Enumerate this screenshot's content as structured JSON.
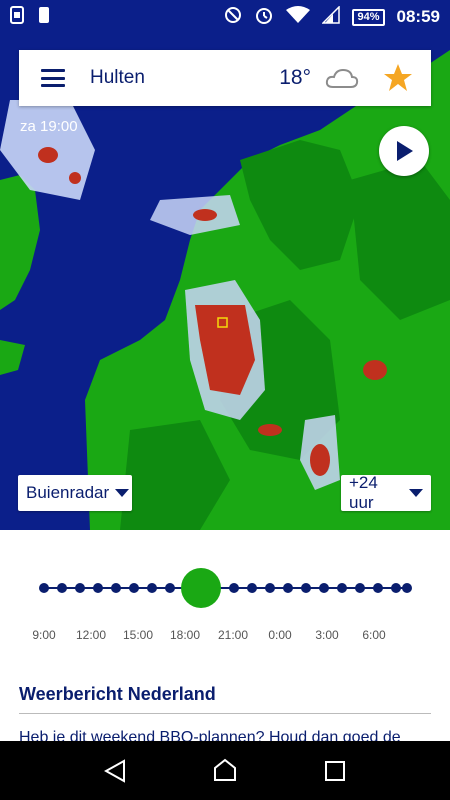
{
  "status": {
    "battery": "94%",
    "time": "08:59",
    "icons": [
      "sim-icon",
      "phone-icon",
      "dnd-icon",
      "alarm-icon",
      "wifi-icon",
      "signal-icon"
    ]
  },
  "header": {
    "location": "Hulten",
    "temperature": "18°",
    "weather_icon": "cloud-icon",
    "favorite_icon": "star-icon"
  },
  "map": {
    "timestamp": "za 19:00",
    "colors": {
      "sea": "#0b1f8a",
      "land": "#1aa814",
      "rain_light": "#c9d6f7",
      "rain_heavy": "#c0301e"
    }
  },
  "controls": {
    "layer_label": "Buienradar",
    "range_label": "+24 uur"
  },
  "timeline": {
    "ticks": [
      "9:00",
      "12:00",
      "15:00",
      "18:00",
      "21:00",
      "0:00",
      "3:00",
      "6:00"
    ],
    "accent": "#1aa814"
  },
  "news": {
    "title": "Weerbericht Nederland",
    "teaser": "Heb je dit weekend BBQ-plannen? Houd dan goed de"
  }
}
